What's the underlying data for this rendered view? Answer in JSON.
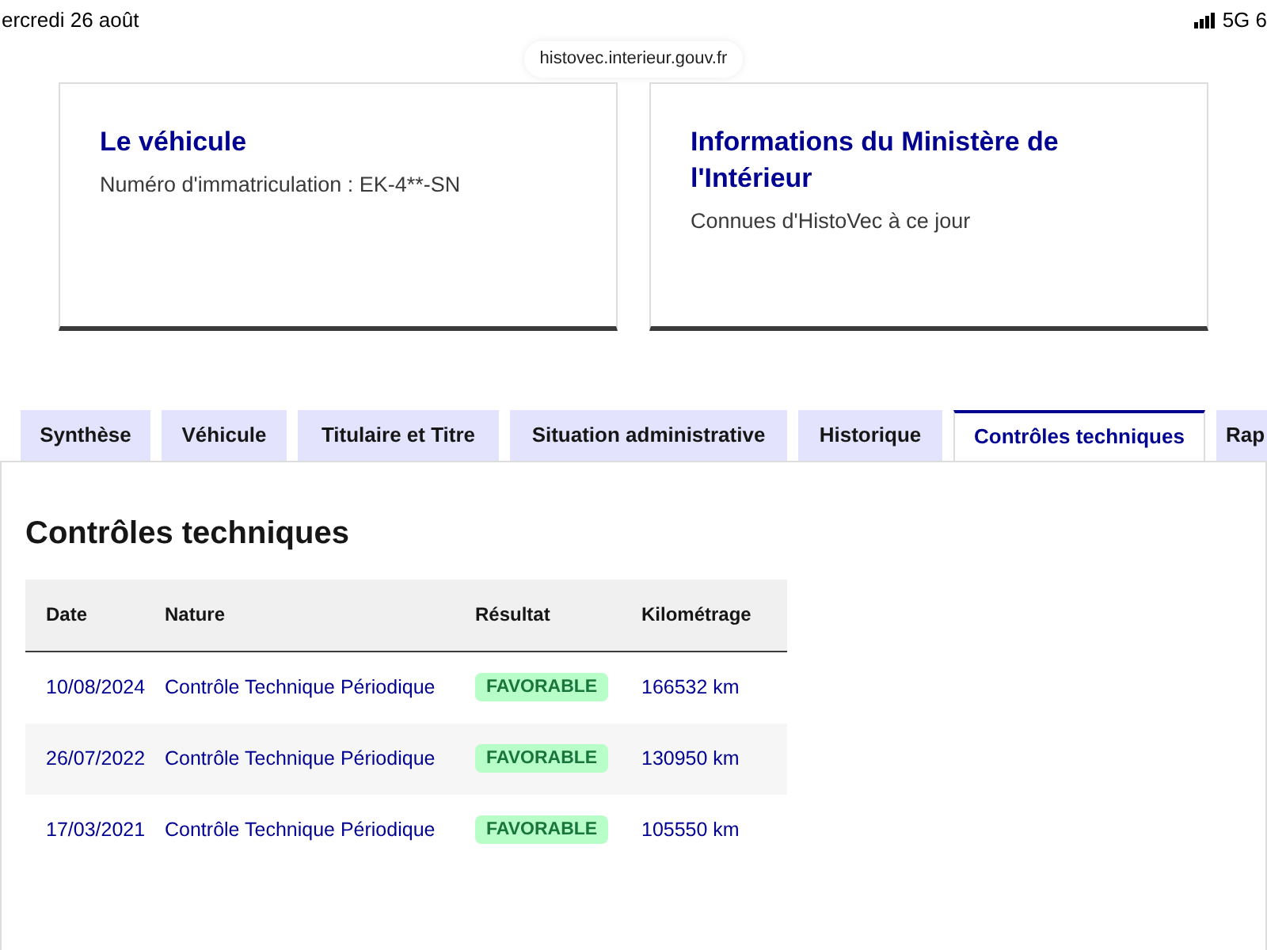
{
  "status_bar": {
    "date": "ercredi 26 août",
    "network": "5G 6"
  },
  "url_bar": {
    "address": "histovec.interieur.gouv.fr"
  },
  "cards": [
    {
      "title": "Le véhicule",
      "text": "Numéro d'immatriculation : EK-4**-SN"
    },
    {
      "title": "Informations du Ministère de l'Intérieur",
      "text": "Connues d'HistoVec à ce jour"
    }
  ],
  "tabs": [
    {
      "label": "Synthèse",
      "selected": false
    },
    {
      "label": "Véhicule",
      "selected": false
    },
    {
      "label": "Titulaire et Titre",
      "selected": false
    },
    {
      "label": "Situation administrative",
      "selected": false
    },
    {
      "label": "Historique",
      "selected": false
    },
    {
      "label": "Contrôles techniques",
      "selected": true
    },
    {
      "label": "Rap",
      "selected": false
    }
  ],
  "section": {
    "title": "Contrôles techniques"
  },
  "table": {
    "columns": [
      "Date",
      "Nature",
      "Résultat",
      "Kilométrage"
    ],
    "rows": [
      {
        "date": "10/08/2024",
        "nature": "Contrôle Technique Périodique",
        "result": "FAVORABLE",
        "mileage": "166532 km"
      },
      {
        "date": "26/07/2022",
        "nature": "Contrôle Technique Périodique",
        "result": "FAVORABLE",
        "mileage": "130950 km"
      },
      {
        "date": "17/03/2021",
        "nature": "Contrôle Technique Périodique",
        "result": "FAVORABLE",
        "mileage": "105550 km"
      }
    ]
  }
}
